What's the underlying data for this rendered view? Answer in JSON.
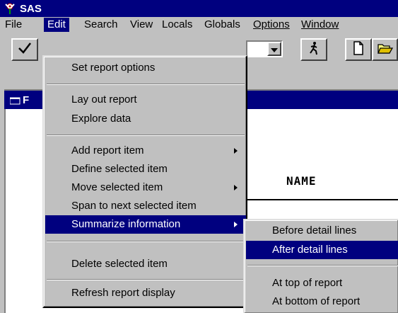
{
  "window": {
    "title": "SAS"
  },
  "menubar": {
    "items": [
      {
        "label": "File"
      },
      {
        "label": "Edit"
      },
      {
        "label": "Search"
      },
      {
        "label": "View"
      },
      {
        "label": "Locals"
      },
      {
        "label": "Globals"
      },
      {
        "label": "Options"
      },
      {
        "label": "Window"
      }
    ]
  },
  "document": {
    "title": "F",
    "column_header": "NAME"
  },
  "edit_menu": {
    "items": [
      {
        "label": "Set report options"
      },
      {
        "label": "Lay out report"
      },
      {
        "label": "Explore data"
      },
      {
        "label": "Add report item"
      },
      {
        "label": "Define selected item"
      },
      {
        "label": "Move selected item"
      },
      {
        "label": "Span to next selected item"
      },
      {
        "label": "Summarize information"
      },
      {
        "label": "Delete selected item"
      },
      {
        "label": "Refresh report display"
      }
    ]
  },
  "summarize_submenu": {
    "items": [
      {
        "label": "Before detail lines"
      },
      {
        "label": "After detail lines"
      },
      {
        "label": "At top of report"
      },
      {
        "label": "At bottom of report"
      }
    ]
  },
  "colors": {
    "titlebar": "#00007f",
    "face": "#c0c0c0",
    "highlight": "#00007f"
  }
}
